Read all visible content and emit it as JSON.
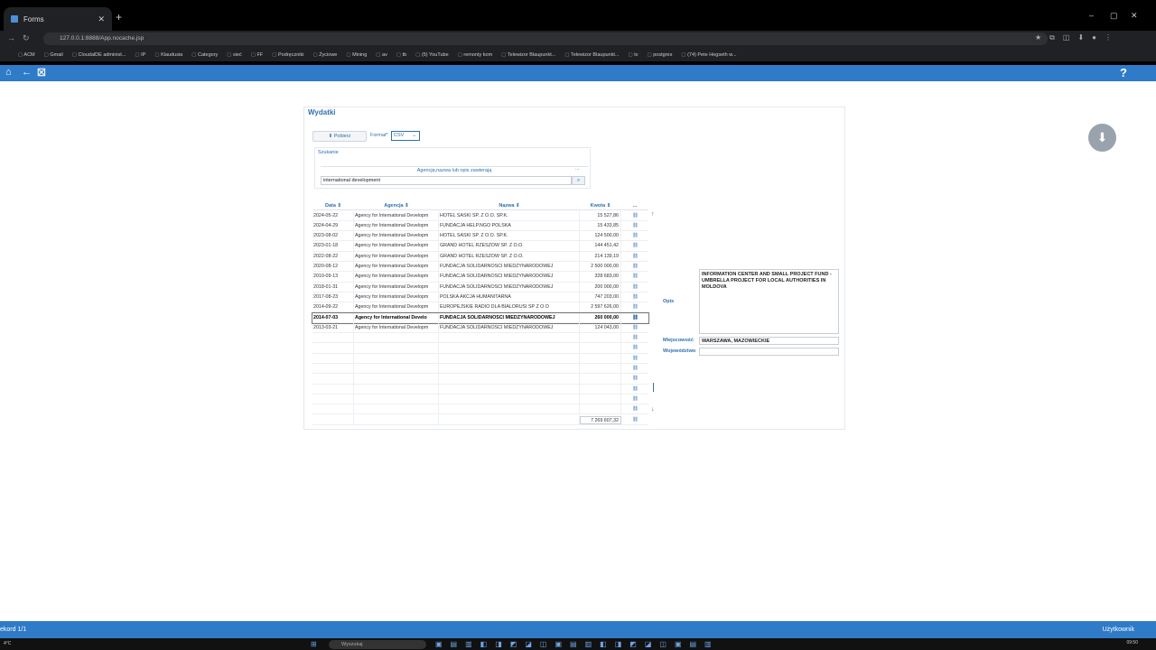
{
  "browser": {
    "tab_title": "Forms",
    "new_tab": "+",
    "close_tab": "✕",
    "url": "127.0.0.1:8888/App.nocache.jsp",
    "window_controls": [
      "–",
      "▢",
      "✕"
    ],
    "bookmarks": [
      "ACM",
      "Gmail",
      "CloudalDE administ...",
      "IP",
      "Klaudusia",
      "Category",
      "sieć",
      "FF",
      "Podręczniki",
      "Życiowe",
      "Mining",
      "av",
      "tb",
      "(5) YouTube",
      "remonty kom",
      "Telewizor Blaupunkt...",
      "Telewizor Blaupunkt...",
      "tv",
      "postgres",
      "(74) Pete Hegseth w..."
    ]
  },
  "app": {
    "title": "Wydatki",
    "download_label": "Pobierz",
    "format_label": "Format*",
    "format_value": "CSV",
    "search_section": "Szukanie",
    "filter_header": "Agencja,nazwa lub opis zawierają",
    "filter_dots": "...",
    "filter_value": "international development",
    "columns": {
      "data": "Data ⇕",
      "agencja": "Agencja ⇕",
      "nazwa": "Nazwa ⇕",
      "kwota": "Kwota ⇕",
      "more": "..."
    },
    "rows": [
      {
        "data": "2024-05-22",
        "agencja": "Agency for International Developm",
        "nazwa": "HOTEL SASKI SP. Z O.O. SP.K.",
        "kwota": "15 527,86"
      },
      {
        "data": "2024-04-29",
        "agencja": "Agency for International Developm",
        "nazwa": "FUNDACJA HELP.NGO POLSKA",
        "kwota": "15 433,85"
      },
      {
        "data": "2023-08-02",
        "agencja": "Agency for International Developm",
        "nazwa": "HOTEL SASKI SP. Z O.O. SP.K.",
        "kwota": "124 500,00"
      },
      {
        "data": "2023-01-18",
        "agencja": "Agency for International Developm",
        "nazwa": "GRAND HOTEL RZESZOW SP. Z O.O.",
        "kwota": "144 451,42"
      },
      {
        "data": "2022-08-22",
        "agencja": "Agency for International Developm",
        "nazwa": "GRAND HOTEL RZESZOW SP. Z O.O.",
        "kwota": "214 139,19"
      },
      {
        "data": "2020-08-12",
        "agencja": "Agency for International Developm",
        "nazwa": "FUNDACJA SOLIDARNOSCI MIEDZYNARODOWEJ",
        "kwota": "2 500 000,00"
      },
      {
        "data": "2019-09-13",
        "agencja": "Agency for International Developm",
        "nazwa": "FUNDACJA SOLIDARNOSCI MIEDZYNARODOWEJ",
        "kwota": "328 683,00"
      },
      {
        "data": "2018-01-31",
        "agencja": "Agency for International Developm",
        "nazwa": "FUNDACJA SOLIDARNOSCI MIEDZYNARODOWEJ",
        "kwota": "200 000,00"
      },
      {
        "data": "2017-08-23",
        "agencja": "Agency for International Developm",
        "nazwa": "POLSKA AKCJA HUMANITARNA",
        "kwota": "747 203,00"
      },
      {
        "data": "2014-09-22",
        "agencja": "Agency for International Developm",
        "nazwa": "EUROPEJSKIE RADIO DLA BIALORUSI SP Z O O",
        "kwota": "2 597 626,00"
      },
      {
        "data": "2014-07-03",
        "agencja": "Agency for International Develo",
        "nazwa": "FUNDACJA SOLIDARNOSCI MIEDZYNARODOWEJ",
        "kwota": "260 000,00",
        "selected": true
      },
      {
        "data": "2013-03-21",
        "agencja": "Agency for International Developm",
        "nazwa": "FUNDACJA SOLIDARNOSCI MIEDZYNARODOWEJ",
        "kwota": "124 043,00"
      }
    ],
    "empty_rows": 9,
    "link_icon": "🔗",
    "total": "7 269 607,32",
    "details": {
      "opis_label": "Opis",
      "opis_value": "INFORMATION CENTER AND SMALL PROJECT FUND -UMBRELLA PROJECT FOR LOCAL AUTHORITIES IN MOLDOVA",
      "miejscowosc_label": "Miejscowość",
      "miejscowosc_value": "WARSZAWA, MAZOWIECKIE",
      "wojewodztwo_label": "Województwo"
    }
  },
  "status": {
    "record": "ekord 1/1",
    "user": "Użytkownik"
  },
  "taskbar": {
    "search_placeholder": "Wyszukaj",
    "weather": "4°C",
    "clock": "09:50"
  },
  "colors": {
    "accent": "#2f7bc8",
    "link": "#2f6fb0"
  }
}
